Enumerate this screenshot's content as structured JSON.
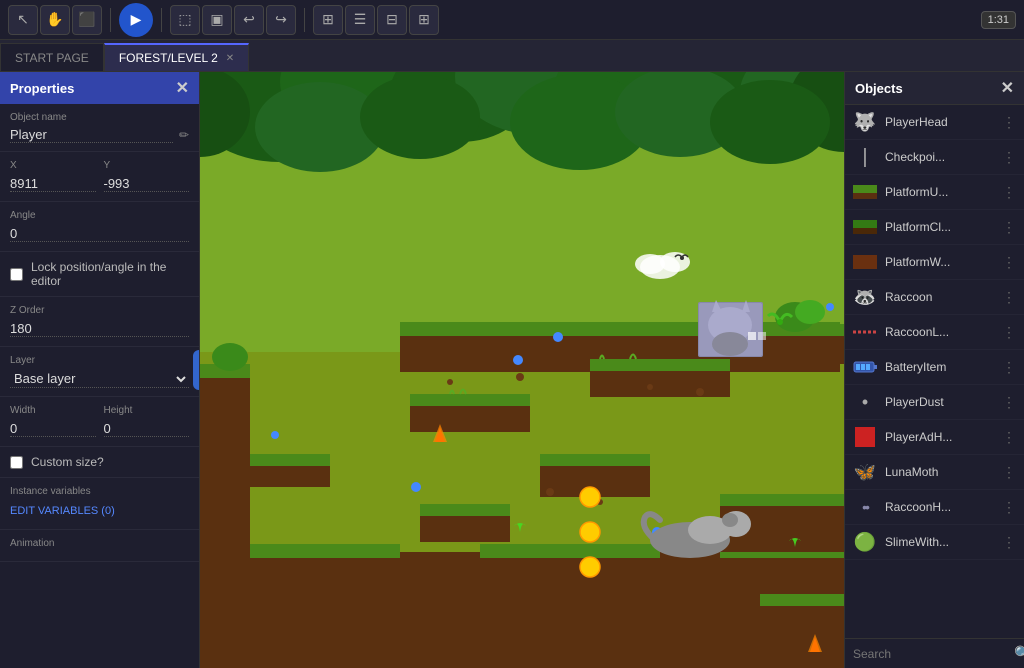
{
  "toolbar": {
    "play_label": "▶",
    "time_display": "1:31",
    "buttons": [
      {
        "name": "cursor-tool",
        "icon": "↖",
        "label": "Cursor"
      },
      {
        "name": "hand-tool",
        "icon": "✋",
        "label": "Pan"
      },
      {
        "name": "zoom-tool",
        "icon": "⬛",
        "label": "Object"
      },
      {
        "name": "select-tool",
        "icon": "⬚",
        "label": "Select"
      },
      {
        "name": "paint-tool",
        "icon": "▣",
        "label": "Paint"
      },
      {
        "name": "undo-btn",
        "icon": "↩",
        "label": "Undo"
      },
      {
        "name": "redo-btn",
        "icon": "↪",
        "label": "Redo"
      },
      {
        "name": "grid-btn",
        "icon": "⊞",
        "label": "Grid"
      },
      {
        "name": "list-btn",
        "icon": "☰",
        "label": "List"
      },
      {
        "name": "layout-btn",
        "icon": "⊟",
        "label": "Layout"
      },
      {
        "name": "tiles-btn",
        "icon": "⊞",
        "label": "Tiles"
      }
    ]
  },
  "tabs": [
    {
      "id": "start",
      "label": "START PAGE",
      "active": false,
      "closable": false
    },
    {
      "id": "level",
      "label": "FOREST/LEVEL 2",
      "active": true,
      "closable": true
    }
  ],
  "properties": {
    "title": "Properties",
    "object_name_label": "Object name",
    "object_name_value": "Player",
    "x_label": "X",
    "x_value": "8911",
    "y_label": "Y",
    "y_value": "-993",
    "angle_label": "Angle",
    "angle_value": "0",
    "lock_label": "Lock position/angle in the editor",
    "zorder_label": "Z Order",
    "zorder_value": "180",
    "layer_label": "Layer",
    "layer_value": "Base layer",
    "width_label": "Width",
    "width_value": "0",
    "height_label": "Height",
    "height_value": "0",
    "custom_size_label": "Custom size?",
    "instance_vars_label": "Instance variables",
    "edit_vars_label": "EDIT VARIABLES (0)",
    "animation_label": "Animation"
  },
  "objects_panel": {
    "title": "Objects",
    "search_placeholder": "Search",
    "items": [
      {
        "name": "PlayerHead",
        "icon": "😺",
        "color": "#cc8844"
      },
      {
        "name": "Checkpoi...",
        "icon": "|",
        "color": "#aaaaaa"
      },
      {
        "name": "PlatformU...",
        "icon": "🟩",
        "color": "#336633"
      },
      {
        "name": "PlatformCl...",
        "icon": "🟩",
        "color": "#228822"
      },
      {
        "name": "PlatformW...",
        "icon": "🟫",
        "color": "#663311"
      },
      {
        "name": "Raccoon",
        "icon": "🦝",
        "color": "#888888"
      },
      {
        "name": "RaccoonL...",
        "icon": "—",
        "color": "#cc4444"
      },
      {
        "name": "BatteryItem",
        "icon": "🔋",
        "color": "#4488cc"
      },
      {
        "name": "PlayerDust",
        "icon": "•",
        "color": "#aaaaaa"
      },
      {
        "name": "PlayerAdH...",
        "icon": "🟥",
        "color": "#cc2222"
      },
      {
        "name": "LunaMoth",
        "icon": "🦋",
        "color": "#44aa44"
      },
      {
        "name": "RaccoonH...",
        "icon": "••",
        "color": "#8888aa"
      },
      {
        "name": "SlimeWith...",
        "icon": "🟢",
        "color": "#44aa22"
      }
    ]
  }
}
